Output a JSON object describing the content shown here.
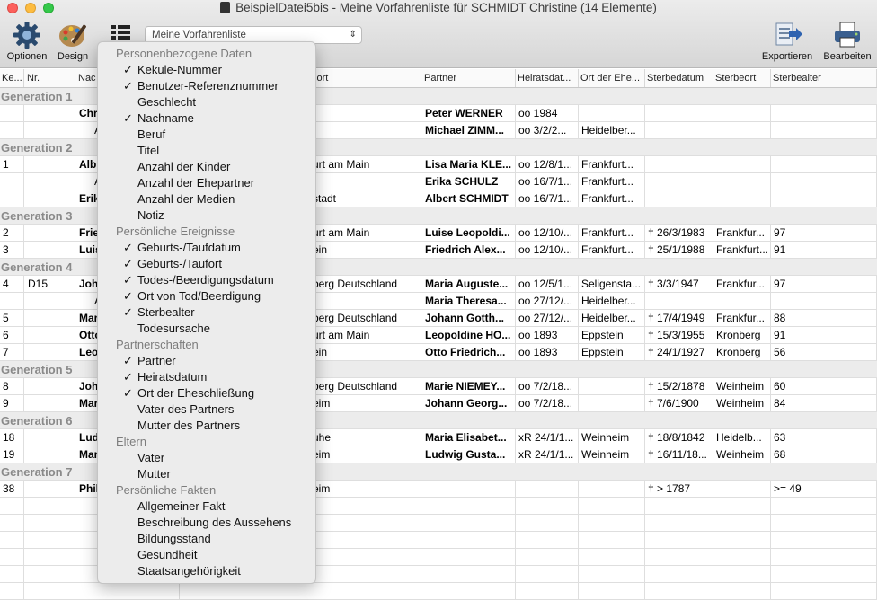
{
  "window": {
    "title": "BeispielDatei5bis - Meine Vorfahrenliste für SCHMIDT Christine (14 Elemente)",
    "close_color": "#fc605c",
    "minimize_color": "#fdbc40",
    "maximize_color": "#34c84a"
  },
  "toolbar": {
    "optionen_label": "Optionen",
    "design_label": "Design",
    "list_selector_value": "Meine Vorfahrenliste",
    "export_label": "Exportieren",
    "edit_label": "Bearbeiten"
  },
  "table": {
    "headers": [
      "Ke...",
      "Nr.",
      "Nac",
      "sort",
      "Partner",
      "Heiratsdat...",
      "Ort der Ehe...",
      "Sterbedatum",
      "Sterbeort",
      "Sterbealter"
    ],
    "rows": [
      {
        "type": "gen",
        "label": "Generation 1"
      },
      {
        "type": "data",
        "cells": [
          "",
          "",
          "Chr",
          "",
          "Peter WERNER",
          "oo 1984",
          "",
          "",
          "",
          ""
        ],
        "bold": [
          2,
          4
        ]
      },
      {
        "type": "data",
        "cells": [
          "",
          "",
          "A",
          "",
          "Michael ZIMM...",
          "oo 3/2/2...",
          "Heidelber...",
          "",
          "",
          ""
        ],
        "bold": [
          4
        ],
        "indent": [
          2
        ]
      },
      {
        "type": "gen",
        "label": "Generation 2"
      },
      {
        "type": "data",
        "cells": [
          "1",
          "",
          "Alb",
          "urt am Main",
          "Lisa Maria KLE...",
          "oo 12/8/1...",
          "Frankfurt...",
          "",
          "",
          ""
        ],
        "bold": [
          2,
          4
        ]
      },
      {
        "type": "data",
        "cells": [
          "",
          "",
          "A",
          "",
          "Erika SCHULZ",
          "oo 16/7/1...",
          "Frankfurt...",
          "",
          "",
          ""
        ],
        "bold": [
          4
        ],
        "indent": [
          2
        ]
      },
      {
        "type": "data",
        "cells": [
          "",
          "",
          "Erik",
          "stadt",
          "Albert SCHMIDT",
          "oo 16/7/1...",
          "Frankfurt...",
          "",
          "",
          ""
        ],
        "bold": [
          2,
          4
        ]
      },
      {
        "type": "gen",
        "label": "Generation 3"
      },
      {
        "type": "data",
        "cells": [
          "2",
          "",
          "Frie",
          "urt am Main",
          "Luise Leopoldi...",
          "oo 12/10/...",
          "Frankfurt...",
          "† 26/3/1983",
          "Frankfur...",
          "97"
        ],
        "bold": [
          2,
          4
        ]
      },
      {
        "type": "data",
        "cells": [
          "3",
          "",
          "Luis",
          "ein",
          "Friedrich Alex...",
          "oo 12/10/...",
          "Frankfurt...",
          "† 25/1/1988",
          "Frankfurt...",
          "91"
        ],
        "bold": [
          2,
          4
        ]
      },
      {
        "type": "gen",
        "label": "Generation 4"
      },
      {
        "type": "data",
        "cells": [
          "4",
          "D15",
          "Joh",
          "berg Deutschland",
          "Maria Auguste...",
          "oo 12/5/1...",
          "Seligensta...",
          "† 3/3/1947",
          "Frankfur...",
          "97"
        ],
        "bold": [
          2,
          4
        ]
      },
      {
        "type": "data",
        "cells": [
          "",
          "",
          "A",
          "",
          "Maria Theresa...",
          "oo 27/12/...",
          "Heidelber...",
          "",
          "",
          ""
        ],
        "bold": [
          4
        ],
        "indent": [
          2
        ]
      },
      {
        "type": "data",
        "cells": [
          "5",
          "",
          "Mar",
          "berg Deutschland",
          "Johann Gotth...",
          "oo 27/12/...",
          "Heidelber...",
          "† 17/4/1949",
          "Frankfur...",
          "88"
        ],
        "bold": [
          2,
          4
        ]
      },
      {
        "type": "data",
        "cells": [
          "6",
          "",
          "Otto",
          "urt am Main",
          "Leopoldine HO...",
          "oo 1893",
          "Eppstein",
          "† 15/3/1955",
          "Kronberg",
          "91"
        ],
        "bold": [
          2,
          4
        ]
      },
      {
        "type": "data",
        "cells": [
          "7",
          "",
          "Leo",
          "ein",
          "Otto Friedrich...",
          "oo 1893",
          "Eppstein",
          "† 24/1/1927",
          "Kronberg",
          "56"
        ],
        "bold": [
          2,
          4
        ]
      },
      {
        "type": "gen",
        "label": "Generation 5"
      },
      {
        "type": "data",
        "cells": [
          "8",
          "",
          "Joh",
          "berg Deutschland",
          "Marie NIEMEY...",
          "oo 7/2/18...",
          "",
          "† 15/2/1878",
          "Weinheim",
          "60"
        ],
        "bold": [
          2,
          4
        ]
      },
      {
        "type": "data",
        "cells": [
          "9",
          "",
          "Mar",
          "eim",
          "Johann Georg...",
          "oo 7/2/18...",
          "",
          "† 7/6/1900",
          "Weinheim",
          "84"
        ],
        "bold": [
          2,
          4
        ]
      },
      {
        "type": "gen",
        "label": "Generation 6"
      },
      {
        "type": "data",
        "cells": [
          "18",
          "",
          "Lud",
          "uhe",
          "Maria Elisabet...",
          "xR 24/1/1...",
          "Weinheim",
          "† 18/8/1842",
          "Heidelb...",
          "63"
        ],
        "bold": [
          2,
          4
        ]
      },
      {
        "type": "data",
        "cells": [
          "19",
          "",
          "Mar",
          "eim",
          "Ludwig Gusta...",
          "xR 24/1/1...",
          "Weinheim",
          "† 16/11/18...",
          "Weinheim",
          "68"
        ],
        "bold": [
          2,
          4
        ]
      },
      {
        "type": "gen",
        "label": "Generation 7"
      },
      {
        "type": "data",
        "cells": [
          "38",
          "",
          "Phil",
          "eim",
          "",
          "",
          "",
          "† > 1787",
          "",
          ">= 49"
        ],
        "bold": [
          2
        ]
      },
      {
        "type": "empty"
      },
      {
        "type": "empty"
      },
      {
        "type": "empty"
      },
      {
        "type": "empty"
      },
      {
        "type": "empty"
      },
      {
        "type": "empty"
      }
    ]
  },
  "menu": {
    "sections": [
      {
        "header": "Personenbezogene Daten",
        "items": [
          {
            "label": "Kekule-Nummer",
            "checked": true
          },
          {
            "label": "Benutzer-Referenznummer",
            "checked": true
          },
          {
            "label": "Geschlecht",
            "checked": false
          },
          {
            "label": "Nachname",
            "checked": true
          },
          {
            "label": "Beruf",
            "checked": false
          },
          {
            "label": "Titel",
            "checked": false
          },
          {
            "label": "Anzahl der Kinder",
            "checked": false
          },
          {
            "label": "Anzahl der Ehepartner",
            "checked": false
          },
          {
            "label": "Anzahl der Medien",
            "checked": false
          },
          {
            "label": "Notiz",
            "checked": false
          }
        ]
      },
      {
        "header": "Persönliche Ereignisse",
        "items": [
          {
            "label": "Geburts-/Taufdatum",
            "checked": true
          },
          {
            "label": "Geburts-/Taufort",
            "checked": true
          },
          {
            "label": "Todes-/Beerdigungsdatum",
            "checked": true
          },
          {
            "label": "Ort von Tod/Beerdigung",
            "checked": true
          },
          {
            "label": "Sterbealter",
            "checked": true
          },
          {
            "label": "Todesursache",
            "checked": false
          }
        ]
      },
      {
        "header": "Partnerschaften",
        "items": [
          {
            "label": "Partner",
            "checked": true
          },
          {
            "label": "Heiratsdatum",
            "checked": true
          },
          {
            "label": "Ort der Eheschließung",
            "checked": true
          },
          {
            "label": "Vater des Partners",
            "checked": false
          },
          {
            "label": "Mutter des Partners",
            "checked": false
          }
        ]
      },
      {
        "header": "Eltern",
        "items": [
          {
            "label": "Vater",
            "checked": false
          },
          {
            "label": "Mutter",
            "checked": false
          }
        ]
      },
      {
        "header": "Persönliche Fakten",
        "items": [
          {
            "label": "Allgemeiner Fakt",
            "checked": false
          },
          {
            "label": "Beschreibung des Aussehens",
            "checked": false
          },
          {
            "label": "Bildungsstand",
            "checked": false
          },
          {
            "label": "Gesundheit",
            "checked": false
          },
          {
            "label": "Staatsangehörigkeit",
            "checked": false
          }
        ]
      }
    ]
  }
}
